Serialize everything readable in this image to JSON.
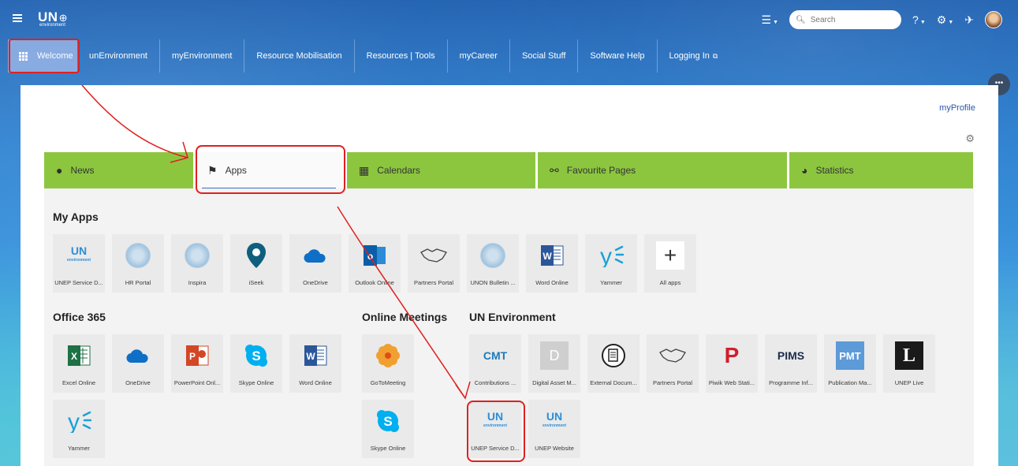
{
  "header": {
    "logo_un": "UN",
    "logo_sub": "environment",
    "search_placeholder": "Search"
  },
  "nav": {
    "items": [
      "Welcome",
      "unEnvironment",
      "myEnvironment",
      "Resource Mobilisation",
      "Resources | Tools",
      "myCareer",
      "Social Stuff",
      "Software Help",
      "Logging In"
    ]
  },
  "page": {
    "myprofile": "myProfile",
    "tabs": [
      "News",
      "Apps",
      "Calendars",
      "Favourite Pages",
      "Statistics"
    ]
  },
  "sections": {
    "my_apps": {
      "title": "My Apps",
      "tiles": [
        "UNEP Service D...",
        "HR Portal",
        "Inspira",
        "iSeek",
        "OneDrive",
        "Outlook Online",
        "Partners Portal",
        "UNON Bulletin ...",
        "Word Online",
        "Yammer",
        "All apps"
      ]
    },
    "office365": {
      "title": "Office 365",
      "tiles": [
        "Excel Online",
        "OneDrive",
        "PowerPoint Onl...",
        "Skype Online",
        "Word Online",
        "Yammer"
      ]
    },
    "online_meetings": {
      "title": "Online Meetings",
      "tiles": [
        "GoToMeeting",
        "Skype Online"
      ]
    },
    "un_environment": {
      "title": "UN Environment",
      "tiles": [
        "Contributions ...",
        "Digital Asset M...",
        "External Docum...",
        "Partners Portal",
        "Piwik Web Stati...",
        "Programme Inf...",
        "Publication Ma...",
        "UNEP Live",
        "UNEP Service D...",
        "UNEP Website"
      ],
      "icon_text": {
        "cmt": "CMT",
        "d": "D",
        "p": "P",
        "pims": "PIMS",
        "pmt": "PMT",
        "l": "L",
        "un": "UN",
        "un_sub": "environment"
      }
    }
  },
  "colors": {
    "tab_green": "#8cc63f",
    "annotation_red": "#e02020",
    "link_blue": "#2a58a6"
  }
}
